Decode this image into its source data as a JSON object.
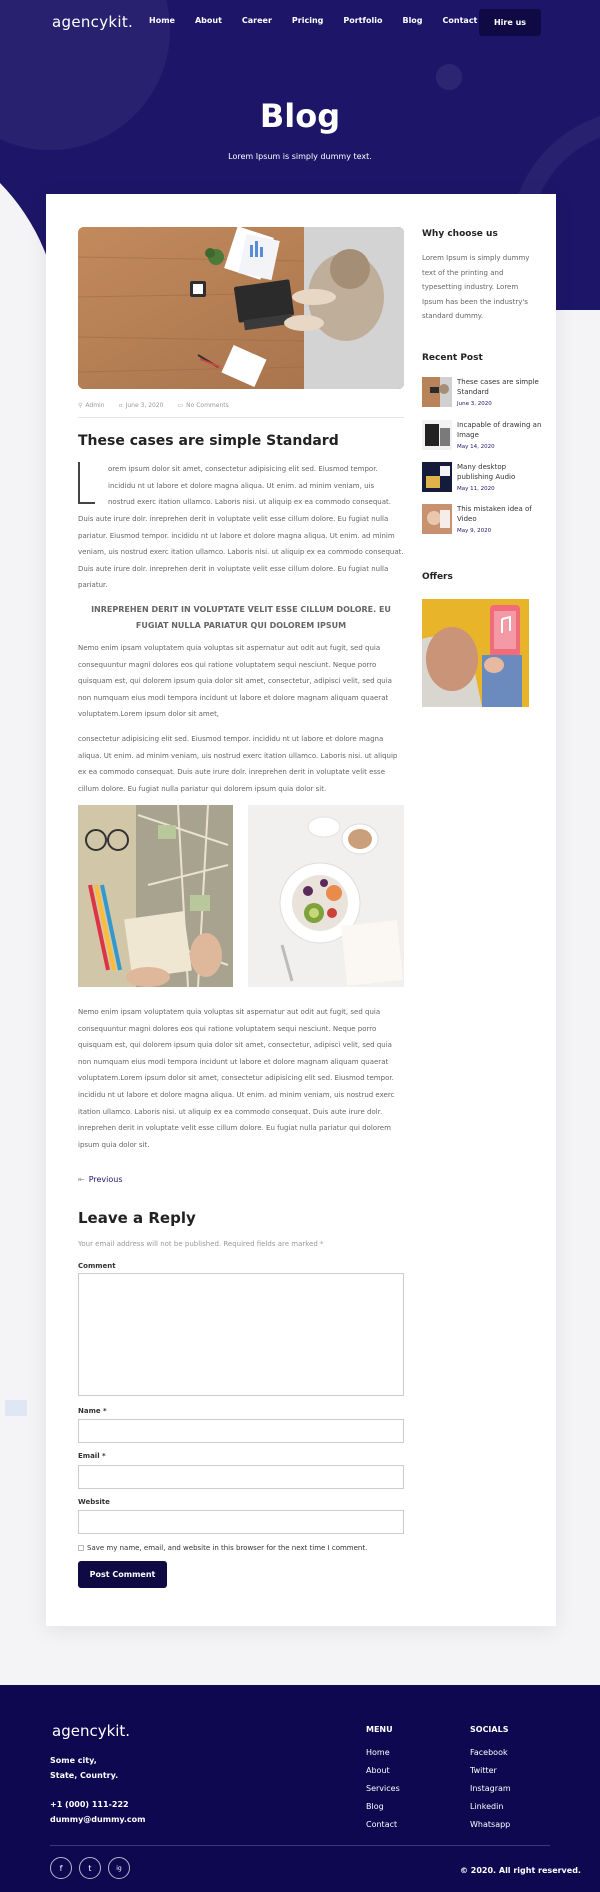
{
  "brand": "agencykit.",
  "nav": [
    "Home",
    "About",
    "Career",
    "Pricing",
    "Portfolio",
    "Blog",
    "Contact us"
  ],
  "hire_label": "Hire us",
  "hero": {
    "title": "Blog",
    "subtitle": "Lorem Ipsum is simply dummy text."
  },
  "post": {
    "meta": {
      "author": "Admin",
      "date": "June 3, 2020",
      "comments": "No Comments"
    },
    "title": "These cases are simple Standard",
    "p1_line1": "orem ipsum dolor sit amet, consectetur adipisicing elit sed. Eiusmod tempor.",
    "p1_line2": "incididu nt ut labore et dolore magna aliqua. Ut enim. ad minim veniam, uis",
    "p1_line3": "nostrud exerc itation ullamco. Laboris nisi. ut aliquip ex ea commodo consequat.",
    "p1_rest": "Duis aute irure dolr. inreprehen derit in voluptate velit esse cillum dolore. Eu fugiat nulla pariatur. Eiusmod tempor. incididu nt ut labore et dolore magna aliqua. Ut enim. ad minim veniam, uis nostrud exerc itation ullamco. Laboris nisi. ut aliquip ex ea commodo consequat. Duis aute irure dolr. inreprehen derit in voluptate velit esse cillum dolore. Eu fugiat nulla pariatur.",
    "quote": "INREPREHEN DERIT IN VOLUPTATE VELIT ESSE CILLUM DOLORE. EU FUGIAT NULLA PARIATUR QUI DOLOREM IPSUM",
    "p2": "Nemo enim ipsam voluptatem quia voluptas sit aspernatur aut odit aut fugit, sed quia consequuntur magni dolores eos qui ratione voluptatem sequi nesciunt. Neque porro quisquam est, qui dolorem ipsum quia dolor sit amet, consectetur, adipisci velit, sed quia non numquam eius modi tempora incidunt ut labore et dolore magnam aliquam quaerat voluptatem.Lorem ipsum dolor sit amet,",
    "p3": "consectetur adipisicing elit sed. Eiusmod tempor. incididu nt ut labore et dolore magna aliqua. Ut enim. ad minim veniam, uis nostrud exerc itation ullamco. Laboris nisi. ut aliquip ex ea commodo consequat. Duis aute irure dolr. inreprehen derit in voluptate velit esse cillum dolore. Eu fugiat nulla pariatur qui dolorem ipsum quia dolor sit.",
    "p4": "Nemo enim ipsam voluptatem quia voluptas sit aspernatur aut odit aut fugit, sed quia consequuntur magni dolores eos qui ratione voluptatem sequi nesciunt. Neque porro quisquam est, qui dolorem ipsum quia dolor sit amet, consectetur, adipisci velit, sed quia non numquam eius modi tempora incidunt ut labore et dolore magnam aliquam quaerat voluptatem.Lorem ipsum dolor sit amet, consectetur adipisicing elit sed. Eiusmod tempor. incididu nt ut labore et dolore magna aliqua. Ut enim. ad minim veniam, uis nostrud exerc itation ullamco. Laboris nisi. ut aliquip ex ea commodo consequat. Duis aute irure dolr. inreprehen derit in voluptate velit esse cillum dolore. Eu fugiat nulla pariatur qui dolorem ipsum quia dolor sit.",
    "previous": "Previous"
  },
  "reply": {
    "title": "Leave a Reply",
    "note": "Your email address will not be published. Required fields are marked *",
    "comment_label": "Comment",
    "name_label": "Name *",
    "email_label": "Email *",
    "website_label": "Website",
    "save_label": "Save my name, email, and website in this browser for the next time I comment.",
    "submit": "Post Comment"
  },
  "sidebar": {
    "why_title": "Why choose us",
    "why_text": "Lorem Ipsum is simply dummy text of the printing and typesetting industry. Lorem Ipsum has been the industry's standard dummy.",
    "recent_title": "Recent Post",
    "recent": [
      {
        "title": "These cases are simple Standard",
        "date": "June 3, 2020"
      },
      {
        "title": "Incapable of drawing an Image",
        "date": "May 14, 2020"
      },
      {
        "title": "Many desktop publishing Audio",
        "date": "May 11, 2020"
      },
      {
        "title": "This mistaken idea of Video",
        "date": "May 9, 2020"
      }
    ],
    "offers_title": "Offers"
  },
  "footer": {
    "brand": "agencykit.",
    "address_1": "Some city,",
    "address_2": "State, Country.",
    "phone": "+1 (000) 111-222",
    "email": "dummy@dummy.com",
    "menu_title": "MENU",
    "menu": [
      "Home",
      "About",
      "Services",
      "Blog",
      "Contact"
    ],
    "socials_title": "SOCIALS",
    "socials": [
      "Facebook",
      "Twitter",
      "Instagram",
      "Linkedin",
      "Whatsapp"
    ],
    "social_icons": [
      "f",
      "t",
      "ig"
    ],
    "copyright": "© 2020. All right reserved."
  },
  "colors": {
    "primary": "#1d1668",
    "dark": "#0e0850",
    "button": "#100a44"
  }
}
